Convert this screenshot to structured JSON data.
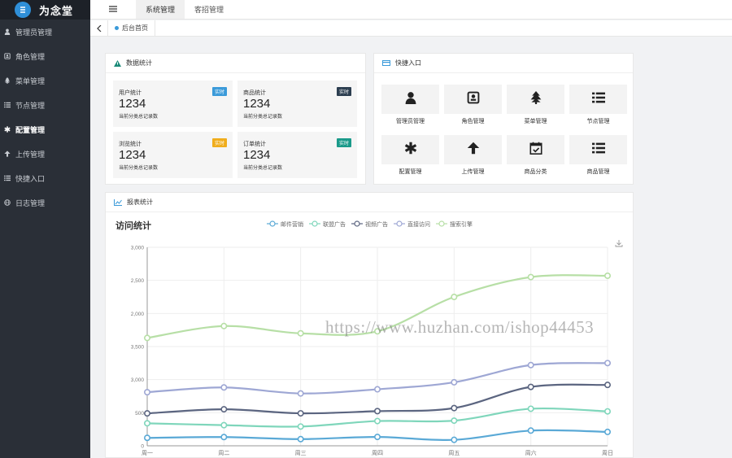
{
  "app": {
    "logo_text": "为念堂"
  },
  "sidebar": {
    "items": [
      {
        "label": "管理员管理",
        "icon": "user-icon",
        "active": false
      },
      {
        "label": "角色管理",
        "icon": "id-card-icon",
        "active": false
      },
      {
        "label": "菜单管理",
        "icon": "tree-icon",
        "active": false
      },
      {
        "label": "节点管理",
        "icon": "list-icon",
        "active": false
      },
      {
        "label": "配置管理",
        "icon": "asterisk-icon",
        "active": true
      },
      {
        "label": "上传管理",
        "icon": "arrow-up-icon",
        "active": false
      },
      {
        "label": "快捷入口",
        "icon": "list-icon",
        "active": false
      },
      {
        "label": "日志管理",
        "icon": "globe-icon",
        "active": false
      }
    ]
  },
  "topbar": {
    "menu_icon": "hamburger-icon",
    "tabs": [
      {
        "label": "系统管理",
        "active": true
      },
      {
        "label": "客招管理",
        "active": false
      }
    ]
  },
  "tabrow": {
    "home_label": "后台首页"
  },
  "stats": {
    "title": "数据统计",
    "cards": [
      {
        "label": "用户统计",
        "badge": "实时",
        "badge_color": "#3a9ad9",
        "value": "1234",
        "sub": "当前分类总记录数"
      },
      {
        "label": "商品统计",
        "badge": "实时",
        "badge_color": "#2c3e50",
        "value": "1234",
        "sub": "当前分类总记录数"
      },
      {
        "label": "浏览统计",
        "badge": "实时",
        "badge_color": "#f0ad1c",
        "value": "1234",
        "sub": "当前分类总记录数"
      },
      {
        "label": "订单统计",
        "badge": "实时",
        "badge_color": "#1a9a8a",
        "value": "1234",
        "sub": "当前分类总记录数"
      }
    ]
  },
  "quick": {
    "title": "快捷入口",
    "items": [
      {
        "label": "管理员管理",
        "icon": "user-icon"
      },
      {
        "label": "角色管理",
        "icon": "id-card-icon"
      },
      {
        "label": "菜单管理",
        "icon": "tree-icon"
      },
      {
        "label": "节点管理",
        "icon": "list-icon"
      },
      {
        "label": "配置管理",
        "icon": "asterisk-icon"
      },
      {
        "label": "上传管理",
        "icon": "arrow-up-icon"
      },
      {
        "label": "商品分类",
        "icon": "calendar-check-icon"
      },
      {
        "label": "商品管理",
        "icon": "list-icon"
      }
    ]
  },
  "report": {
    "title": "报表统计",
    "download_icon": "download-icon"
  },
  "chart_data": {
    "type": "line",
    "title": "访问统计",
    "categories": [
      "周一",
      "周二",
      "周三",
      "周四",
      "周五",
      "周六",
      "周日"
    ],
    "yticks": [
      "0",
      "500",
      "3,000",
      "3,500",
      "2,000",
      "2,500",
      "3,000"
    ],
    "ylim": [
      0,
      3000
    ],
    "legend_position": "top-center",
    "grid": true,
    "series": [
      {
        "name": "邮件营销",
        "color": "#5aa9d6",
        "values": [
          120,
          132,
          101,
          134,
          90,
          230,
          210
        ]
      },
      {
        "name": "联盟广告",
        "color": "#7fd6bb",
        "values": [
          340,
          312,
          291,
          374,
          380,
          560,
          520
        ]
      },
      {
        "name": "视频广告",
        "color": "#5b6580",
        "values": [
          490,
          552,
          491,
          524,
          570,
          890,
          920
        ]
      },
      {
        "name": "直接访问",
        "color": "#9ea7d4",
        "values": [
          810,
          882,
          791,
          854,
          960,
          1220,
          1250
        ]
      },
      {
        "name": "搜索引擎",
        "color": "#b7dfa6",
        "values": [
          1630,
          1810,
          1700,
          1730,
          2250,
          2550,
          2570
        ]
      }
    ]
  },
  "watermark": "https://www.huzhan.com/ishop44453"
}
